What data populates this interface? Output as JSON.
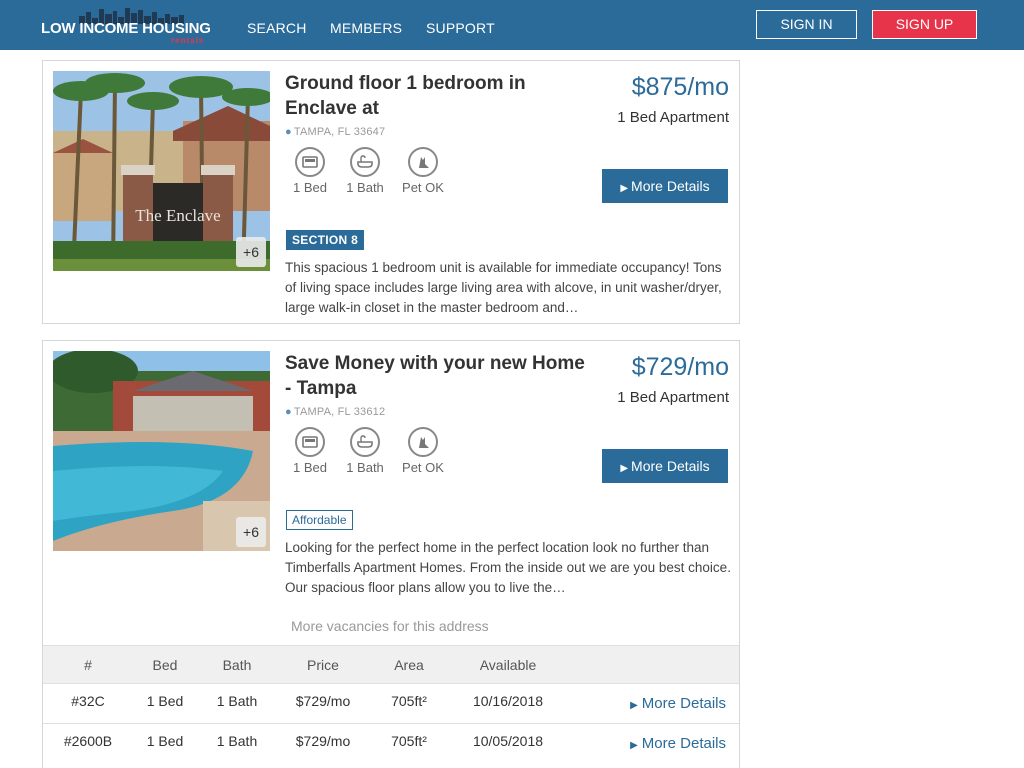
{
  "header": {
    "logo_text": "LOW INCOME HOUSING",
    "logo_sub": "rentals",
    "nav": [
      "SEARCH",
      "MEMBERS",
      "SUPPORT"
    ],
    "sign_in": "SIGN IN",
    "sign_up": "SIGN UP"
  },
  "colors": {
    "brand": "#2b6b99",
    "accent": "#e8344a"
  },
  "listings": [
    {
      "title": "Ground floor 1 bedroom in Enclave at",
      "location": "TAMPA, FL 33647",
      "price": "$875/mo",
      "type": "1 Bed Apartment",
      "photo_count": "+6",
      "amenities": [
        "1 Bed",
        "1 Bath",
        "Pet OK"
      ],
      "more_details": "More Details",
      "badge": "SECTION 8",
      "description": "This spacious 1 bedroom unit is available for immediate occupancy! Tons of living space includes large living area with alcove, in unit washer/dryer, large walk-in closet in the master bedroom and…"
    },
    {
      "title": "Save Money with your new Home - Tampa",
      "location": "TAMPA, FL 33612",
      "price": "$729/mo",
      "type": "1 Bed Apartment",
      "photo_count": "+6",
      "amenities": [
        "1 Bed",
        "1 Bath",
        "Pet OK"
      ],
      "more_details": "More Details",
      "badge": "Affordable",
      "description": "Looking for the perfect home in the perfect location look no further than Timberfalls Apartment Homes. From the inside out we are you best choice. Our spacious floor plans allow you to live the…",
      "more_vacancies": "More vacancies for this address",
      "vacancy_headers": [
        "#",
        "Bed",
        "Bath",
        "Price",
        "Area",
        "Available"
      ],
      "vacancies": [
        {
          "unit": "#32C",
          "bed": "1 Bed",
          "bath": "1 Bath",
          "price": "$729/mo",
          "area": "705ft²",
          "available": "10/16/2018",
          "link": "More Details"
        },
        {
          "unit": "#2600B",
          "bed": "1 Bed",
          "bath": "1 Bath",
          "price": "$729/mo",
          "area": "705ft²",
          "available": "10/05/2018",
          "link": "More Details"
        }
      ]
    }
  ]
}
